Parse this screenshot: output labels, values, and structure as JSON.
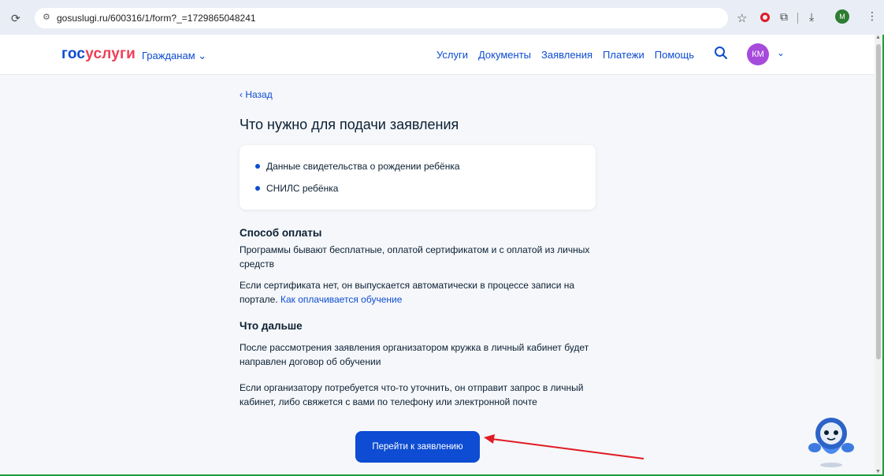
{
  "browser": {
    "reload_icon": "reload-icon",
    "url": "gosuslugi.ru/600316/1/form?_=1729865048241",
    "profile_initial": "M"
  },
  "header": {
    "logo_part1": "гос",
    "logo_part2": "услуги",
    "citizens_menu": "Гражданам",
    "nav": [
      {
        "label": "Услуги"
      },
      {
        "label": "Документы"
      },
      {
        "label": "Заявления"
      },
      {
        "label": "Платежи"
      },
      {
        "label": "Помощь"
      }
    ],
    "avatar_initials": "КМ"
  },
  "main": {
    "back_label": "Назад",
    "title": "Что нужно для подачи заявления",
    "requirements": [
      "Данные свидетельства о рождении ребёнка",
      "СНИЛС ребёнка"
    ],
    "payment": {
      "title": "Способ оплаты",
      "p1": "Программы бывают бесплатные, оплатой сертификатом и с оплатой из личных средств",
      "p2_text": "Если сертификата нет, он выпускается автоматически в процессе записи на портале.",
      "p2_link": "Как оплачивается обучение"
    },
    "next": {
      "title": "Что дальше",
      "p1": "После рассмотрения заявления организатором кружка в личный кабинет будет направлен договор об обучении",
      "p2": "Если организатору потребуется что-то уточнить, он отправит запрос в личный кабинет, либо свяжется с вами по телефону или электронной почте"
    },
    "cta_label": "Перейти к заявлению"
  },
  "colors": {
    "brand_blue": "#0d4cd3",
    "brand_red": "#ee3f58",
    "annotation_arrow": "#e01b24",
    "frame_green": "#1f9e3a"
  }
}
